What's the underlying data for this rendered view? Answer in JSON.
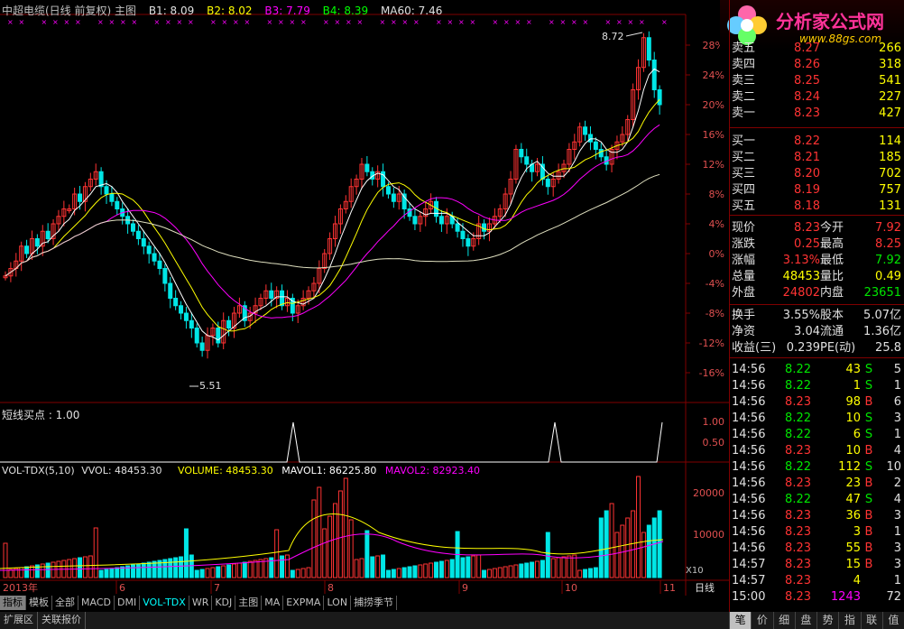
{
  "header": {
    "title": "中超电缆(日线 前复权) 主图",
    "b1": "B1: 8.09",
    "b2": "B2: 8.02",
    "b3": "B3: 7.79",
    "b4": "B4: 8.39",
    "ma60": "MA60: 7.46"
  },
  "logo": {
    "name": "分析家公式网",
    "url": "www.88gs.com"
  },
  "main_chart": {
    "high_label": "8.72",
    "low_label": "5.51",
    "y_axis": [
      "28%",
      "24%",
      "20%",
      "16%",
      "12%",
      "8%",
      "4%",
      "0%",
      "-4%",
      "-8%",
      "-12%",
      "-16%"
    ]
  },
  "signal_panel": {
    "title": "短线买点 : 1.00",
    "y_axis": [
      "1.00",
      "0.50"
    ]
  },
  "vol_panel": {
    "name": "VOL-TDX(5,10)",
    "vvol": "VVOL: 48453.30",
    "volume": "VOLUME: 48453.30",
    "mavol1": "MAVOL1: 86225.80",
    "mavol2": "MAVOL2: 82923.40",
    "y_axis": [
      "20000",
      "10000"
    ],
    "unit": "X10"
  },
  "x_axis": {
    "year": "2013年",
    "months": [
      "6",
      "7",
      "8",
      "9",
      "10",
      "11"
    ],
    "period": "日线"
  },
  "bottom_tabs": [
    "指标",
    "模板",
    "全部",
    "MACD",
    "DMI",
    "VOL-TDX",
    "WR",
    "KDJ",
    "主图",
    "MA",
    "EXPMA",
    "LON",
    "捕捞季节"
  ],
  "extra_tabs": [
    "扩展区",
    "关联报价"
  ],
  "order_book": {
    "asks": [
      {
        "label": "卖五",
        "price": "8.27",
        "vol": "266"
      },
      {
        "label": "卖四",
        "price": "8.26",
        "vol": "318"
      },
      {
        "label": "卖三",
        "price": "8.25",
        "vol": "541"
      },
      {
        "label": "卖二",
        "price": "8.24",
        "vol": "227"
      },
      {
        "label": "卖一",
        "price": "8.23",
        "vol": "427"
      }
    ],
    "bids": [
      {
        "label": "买一",
        "price": "8.22",
        "vol": "114"
      },
      {
        "label": "买二",
        "price": "8.21",
        "vol": "185"
      },
      {
        "label": "买三",
        "price": "8.20",
        "vol": "702"
      },
      {
        "label": "买四",
        "price": "8.19",
        "vol": "757"
      },
      {
        "label": "买五",
        "price": "8.18",
        "vol": "131"
      }
    ]
  },
  "quote": [
    {
      "l1": "现价",
      "v1": "8.23",
      "c1": "red",
      "l2": "今开",
      "v2": "7.92",
      "c2": "red"
    },
    {
      "l1": "涨跌",
      "v1": "0.25",
      "c1": "red",
      "l2": "最高",
      "v2": "8.25",
      "c2": "red"
    },
    {
      "l1": "涨幅",
      "v1": "3.13%",
      "c1": "red",
      "l2": "最低",
      "v2": "7.92",
      "c2": "green"
    },
    {
      "l1": "总量",
      "v1": "48453",
      "c1": "yellow",
      "l2": "量比",
      "v2": "0.49",
      "c2": "yellow"
    },
    {
      "l1": "外盘",
      "v1": "24802",
      "c1": "red",
      "l2": "内盘",
      "v2": "23651",
      "c2": "green"
    }
  ],
  "fundamentals": [
    {
      "l1": "换手",
      "v1": "3.55%",
      "l2": "股本",
      "v2": "5.07亿"
    },
    {
      "l1": "净资",
      "v1": "3.04",
      "l2": "流通",
      "v2": "1.36亿"
    },
    {
      "l1": "收益(三)",
      "v1": "0.239",
      "l2": "PE(动)",
      "v2": "25.8"
    }
  ],
  "ticks": [
    {
      "t": "14:56",
      "p": "8.22",
      "pc": "green",
      "v": "43",
      "vc": "yellow",
      "s": "S",
      "n": "5"
    },
    {
      "t": "14:56",
      "p": "8.22",
      "pc": "green",
      "v": "1",
      "vc": "yellow",
      "s": "S",
      "n": "1"
    },
    {
      "t": "14:56",
      "p": "8.23",
      "pc": "red",
      "v": "98",
      "vc": "yellow",
      "s": "B",
      "n": "6"
    },
    {
      "t": "14:56",
      "p": "8.22",
      "pc": "green",
      "v": "10",
      "vc": "yellow",
      "s": "S",
      "n": "3"
    },
    {
      "t": "14:56",
      "p": "8.22",
      "pc": "green",
      "v": "6",
      "vc": "yellow",
      "s": "S",
      "n": "1"
    },
    {
      "t": "14:56",
      "p": "8.23",
      "pc": "red",
      "v": "10",
      "vc": "yellow",
      "s": "B",
      "n": "4"
    },
    {
      "t": "14:56",
      "p": "8.22",
      "pc": "green",
      "v": "112",
      "vc": "yellow",
      "s": "S",
      "n": "10"
    },
    {
      "t": "14:56",
      "p": "8.23",
      "pc": "red",
      "v": "23",
      "vc": "yellow",
      "s": "B",
      "n": "2"
    },
    {
      "t": "14:56",
      "p": "8.22",
      "pc": "green",
      "v": "47",
      "vc": "yellow",
      "s": "S",
      "n": "4"
    },
    {
      "t": "14:56",
      "p": "8.23",
      "pc": "red",
      "v": "36",
      "vc": "yellow",
      "s": "B",
      "n": "3"
    },
    {
      "t": "14:56",
      "p": "8.23",
      "pc": "red",
      "v": "3",
      "vc": "yellow",
      "s": "B",
      "n": "1"
    },
    {
      "t": "14:56",
      "p": "8.23",
      "pc": "red",
      "v": "55",
      "vc": "yellow",
      "s": "B",
      "n": "3"
    },
    {
      "t": "14:57",
      "p": "8.23",
      "pc": "red",
      "v": "15",
      "vc": "yellow",
      "s": "B",
      "n": "3"
    },
    {
      "t": "14:57",
      "p": "8.23",
      "pc": "red",
      "v": "4",
      "vc": "yellow",
      "s": "",
      "n": "1"
    },
    {
      "t": "15:00",
      "p": "8.23",
      "pc": "red",
      "v": "1243",
      "vc": "magenta",
      "s": "",
      "n": "72"
    }
  ],
  "side_tabs": [
    "笔",
    "价",
    "细",
    "盘",
    "势",
    "指",
    "联",
    "值"
  ],
  "colors": {
    "up": "#ff3333",
    "down": "#00e6e6",
    "ma_white": "#ffffff",
    "ma_yellow": "#ffff00",
    "ma_magenta": "#ff00ff",
    "ma60": "#e0e0c0",
    "grid": "#800000"
  }
}
